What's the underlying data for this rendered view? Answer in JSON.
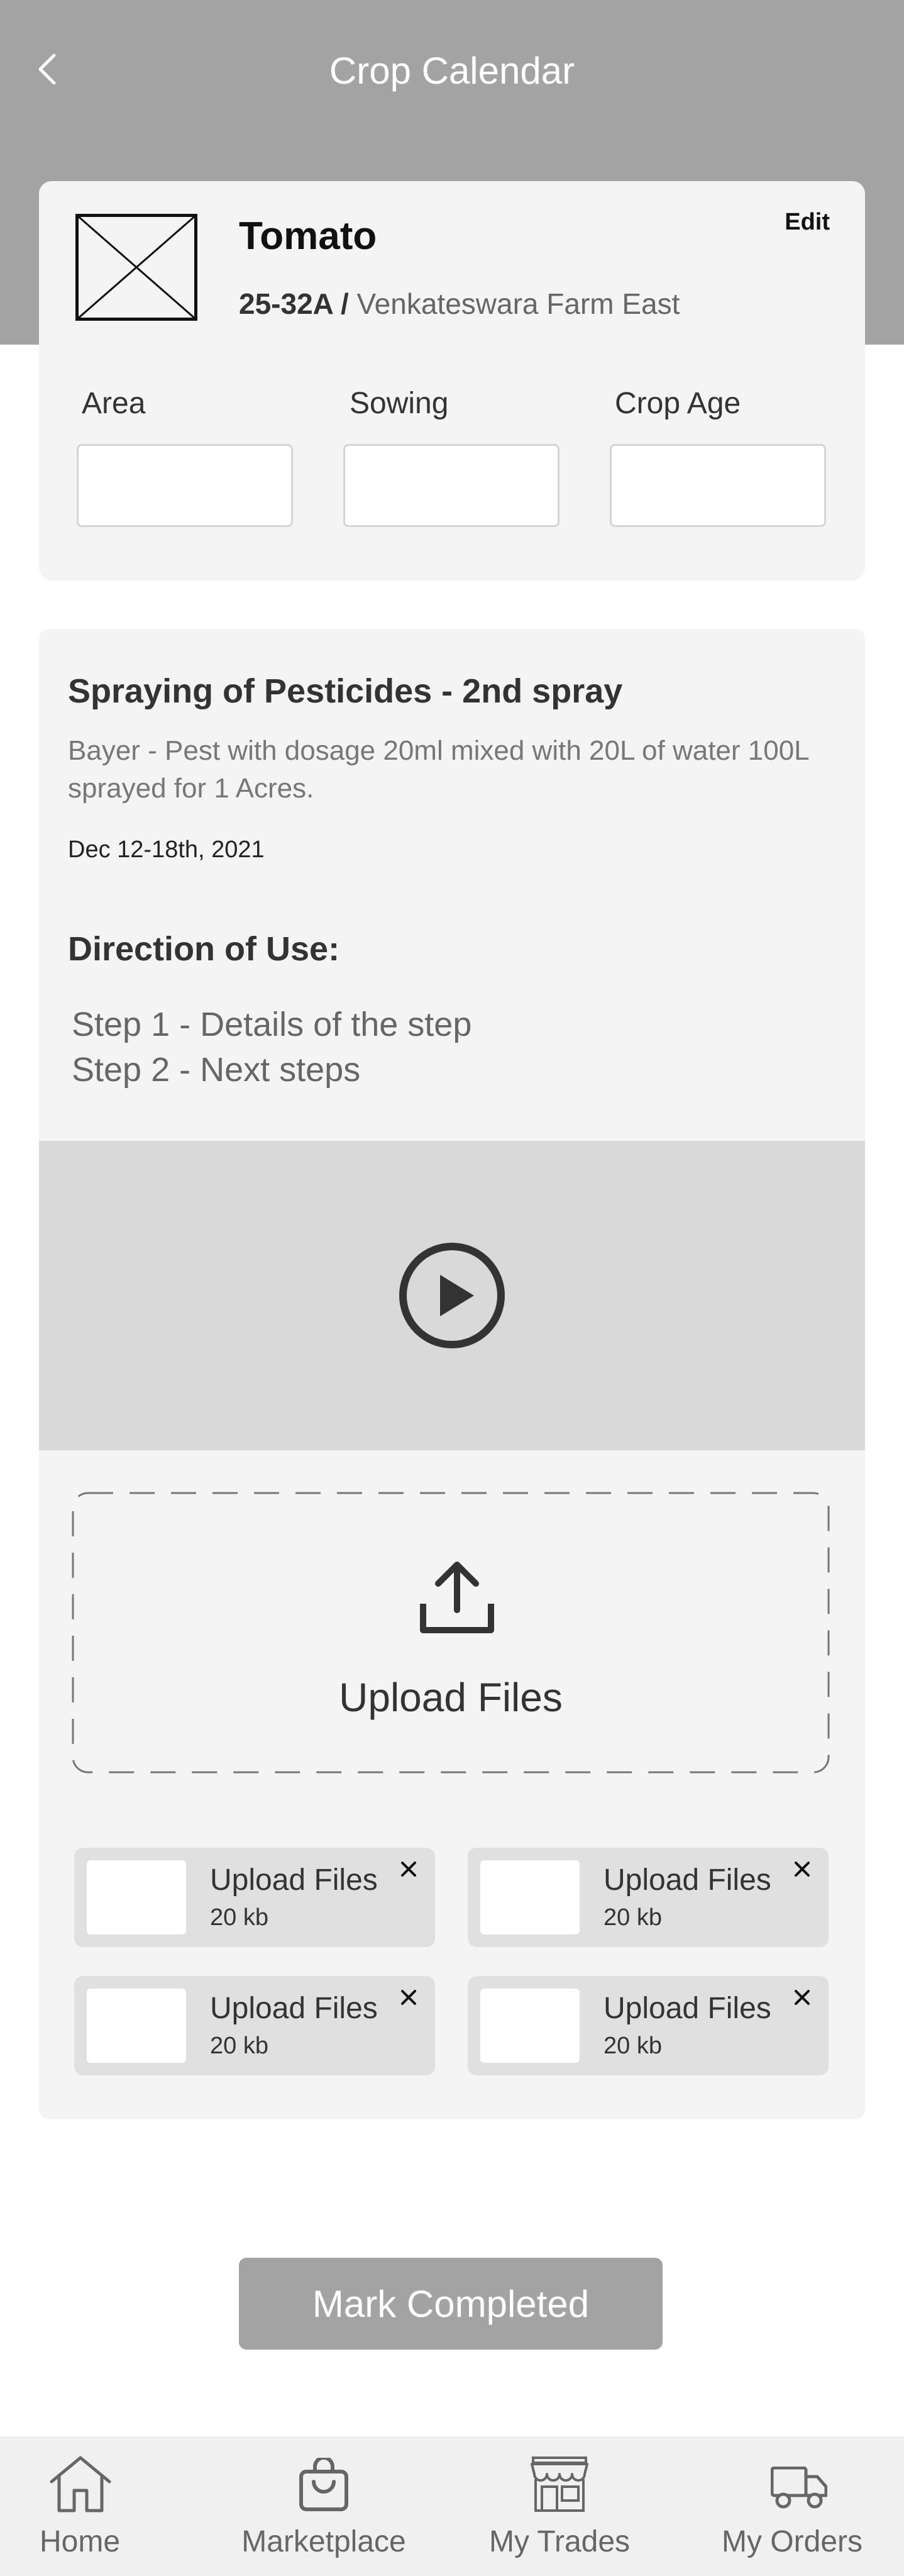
{
  "header": {
    "title": "Crop Calendar",
    "back_icon": "chevron-left-icon"
  },
  "crop": {
    "name": "Tomato",
    "plot_id": "25-32A",
    "separator": " / ",
    "farm": "Venkateswara Farm East",
    "edit_label": "Edit",
    "fields": [
      {
        "label": "Area",
        "value": ""
      },
      {
        "label": "Sowing",
        "value": ""
      },
      {
        "label": "Crop Age",
        "value": ""
      }
    ]
  },
  "task": {
    "title": "Spraying of Pesticides - 2nd spray",
    "description": "Bayer - Pest with dosage 20ml mixed with 20L of water 100L sprayed for 1 Acres.",
    "date": "Dec 12-18th, 2021",
    "direction_title": "Direction of Use:",
    "steps": [
      "Step 1 - Details of the step",
      "Step 2 - Next steps"
    ],
    "video_icon": "play-icon",
    "upload_label": "Upload Files",
    "upload_icon": "upload-icon",
    "files": [
      {
        "name": "Upload Files",
        "size": "20 kb"
      },
      {
        "name": "Upload Files",
        "size": "20 kb"
      },
      {
        "name": "Upload Files",
        "size": "20 kb"
      },
      {
        "name": "Upload Files",
        "size": "20 kb"
      }
    ]
  },
  "mark_completed_label": "Mark Completed",
  "nav": [
    {
      "label": "Home",
      "icon": "home-icon"
    },
    {
      "label": "Marketplace",
      "icon": "shopping-bag-icon"
    },
    {
      "label": "My Trades",
      "icon": "store-icon"
    },
    {
      "label": "My Orders",
      "icon": "truck-icon"
    }
  ],
  "colors": {
    "header_bg": "#a3a3a3",
    "card_bg": "#f4f4f4",
    "button_bg": "#a3a3a3",
    "nav_bg": "#f0f0f0"
  }
}
